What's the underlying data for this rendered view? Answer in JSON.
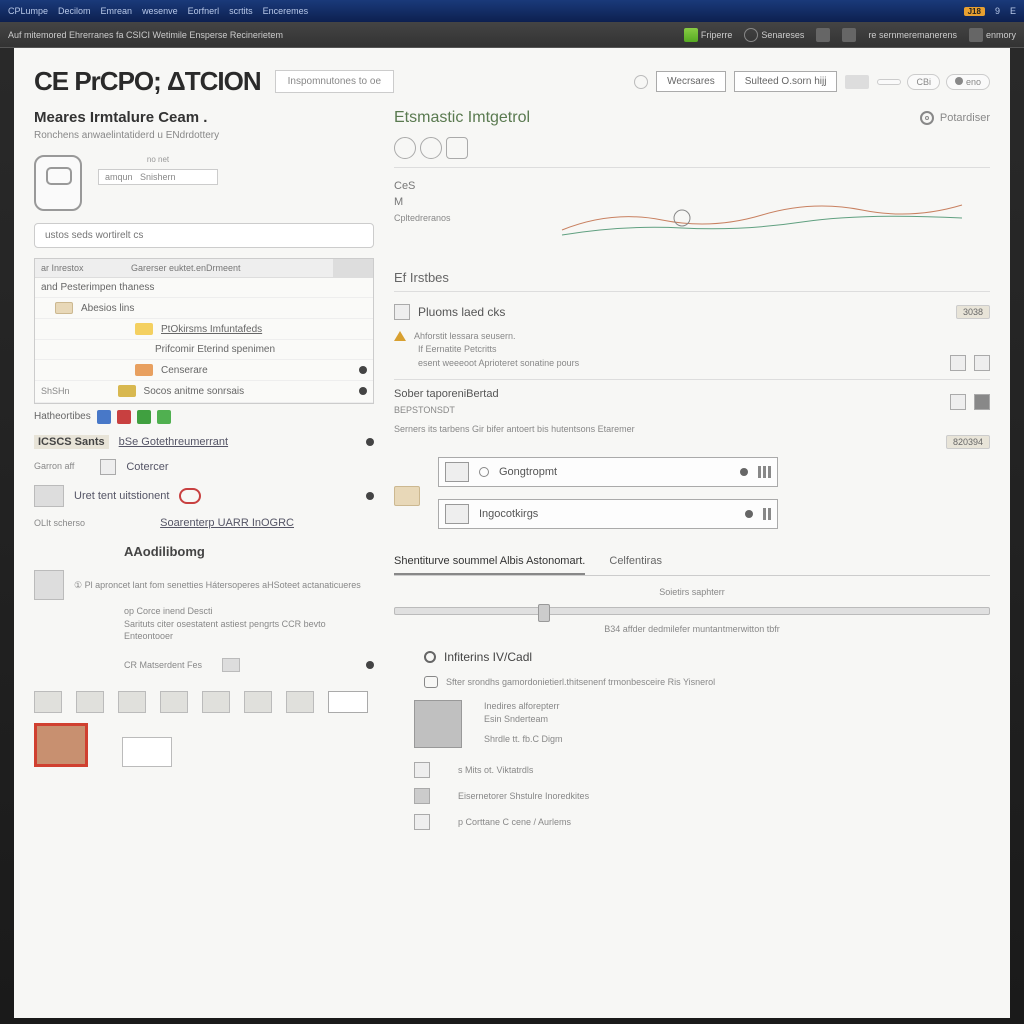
{
  "topbar": {
    "left": [
      "CPLumpe",
      "Decilom",
      "Emrean",
      "wesenve",
      "Eorfnerl",
      "scrtits",
      "Enceremes"
    ],
    "right_badge": "J18",
    "right_items": [
      "9",
      "E"
    ]
  },
  "subbar": {
    "crumb": "Auf mitemored Ehrerranes fa CSICI Wetimile Ensperse Recinerietem",
    "actions": [
      "Friperre",
      "Senareses",
      "",
      "",
      "re sernmeremanerens",
      "enmory"
    ]
  },
  "header": {
    "logo": "CE PrCPO; ΔTCION",
    "tab": "Inspomnutones to oe",
    "btn1": "Wecrsares",
    "btn2": "Sulteed O.sorn hijj",
    "pills": [
      "",
      "CBi",
      "eno"
    ]
  },
  "left": {
    "title": "Meares Irmtalure Ceam .",
    "subtitle": "Ronchens anwaelintatiderd u ENdrdottery",
    "cam_label": "no net",
    "cam_value": "amqun   Snishern",
    "search_placeholder": "ustos seds wortirelt cs",
    "list_headcols": [
      "ar Inrestox",
      "Garerser euktet.enDrmeent",
      ""
    ],
    "list_row1": "and Pesterimpen thaness",
    "items": [
      {
        "label": "Abesios lins"
      },
      {
        "label": "PtOkirsms Imfuntafeds",
        "swatch": "sw-yellow"
      },
      {
        "label": "Prifcomir Eterind spenimen"
      },
      {
        "label": "Censerare",
        "swatch": "sw-orange",
        "dot": true
      },
      {
        "label": "Socos anitme sonrsais",
        "pre": "ShSHn",
        "swatch": "sw-gold",
        "dot": true
      }
    ],
    "badges_label": "Hatheortibes",
    "links": [
      {
        "head": "ICSCS   Sants",
        "text": "bSe Gotethreumerrant",
        "dot": true
      },
      {
        "head": "Garron aff",
        "text": "Cotercer",
        "boxed": true
      },
      {
        "head": "",
        "text": "Uret tent uitstionent",
        "circle": true,
        "dot": true
      },
      {
        "head": "OLIt scherso",
        "text": "Soarenterp UARR InOGRC",
        "underline": true
      }
    ],
    "sub_title": "AAodilibomg",
    "para1": "① Pl aproncet lant fom senetties Hátersoperes aHSoteet actanaticueres",
    "para2a": "op Corce inend Descti",
    "para2b": "Sarituts citer osestatent astiest pengrts CCR bevto Enteontooer",
    "para3": "CR Matserdent Fes",
    "thumbs_label": ""
  },
  "right": {
    "title": "Etsmastic Imtgetrol",
    "headlink": "Potardiser",
    "cat1": "CeS",
    "cat1b": "M",
    "cat1_sub": "Cpltedreranos",
    "cat2": "Ef Irstbes",
    "rowA": "Pluoms laed cks",
    "rowA_badge": "3038",
    "warnA": "Ahforstit lessara seusern.",
    "warnA_sub1": "If Eernatite Petcritts",
    "warnA_sub2": "esent weeeoot Aprioteret sonatine pours",
    "icons_rowA": [
      "",
      ""
    ],
    "boxB_title": "Sober taporeniBertad",
    "boxB_sub": "BEPSTONSDT",
    "boxB_desc": "Serners its tarbens Gir bifer antoert bis hutentsons Etaremer",
    "boxB_badge": "820394",
    "opt1": "Gongtropmt",
    "opt2": "Ingocotkirgs",
    "tabs": [
      "Shentiturve soummel Albis Astonomart.",
      "Celfentiras"
    ],
    "slider_label": "Soietirs saphterr",
    "slider_caption": "B34 affder dedmilefer muntantmerwitton tbfr",
    "bullet1": "Infiterins IV/Cadl",
    "speech": "Sfter srondhs gamordonietierl.thitsenenf trmonbesceire Ris Yisnerol",
    "thumb_lines": [
      "Inedires alforepterr",
      "Esin Snderteam",
      "Shrdle tt. fb.C Digm"
    ],
    "bottom_items": [
      "s Mits ot. Viktatrdls",
      "Eisernetorer Shstulre Inoredkites",
      "p Corttane C cene / Aurlems"
    ]
  }
}
